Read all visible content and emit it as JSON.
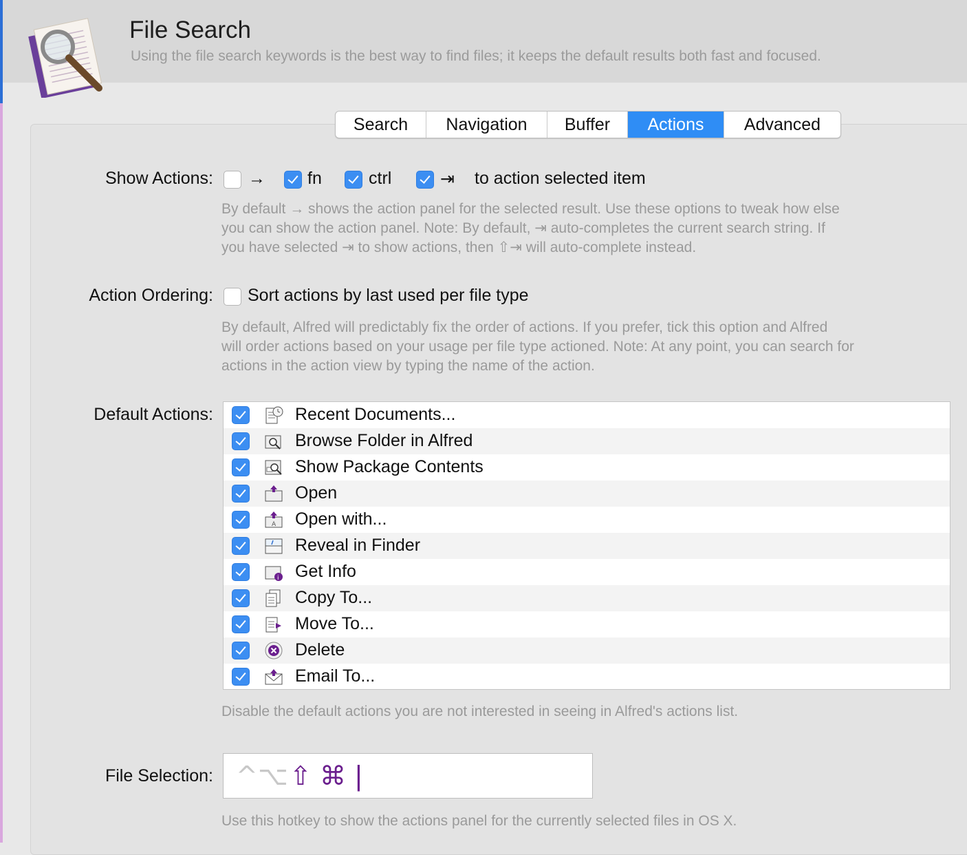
{
  "header": {
    "title": "File Search",
    "subtitle": "Using the file search keywords is the best way to find files; it keeps the default results both fast and focused."
  },
  "tabs": [
    {
      "label": "Search",
      "active": false
    },
    {
      "label": "Navigation",
      "active": false
    },
    {
      "label": "Buffer",
      "active": false
    },
    {
      "label": "Actions",
      "active": true
    },
    {
      "label": "Advanced",
      "active": false
    }
  ],
  "show_actions": {
    "label": "Show Actions:",
    "options": [
      {
        "glyph": "→",
        "checked": false
      },
      {
        "glyph": "fn",
        "checked": true
      },
      {
        "glyph": "ctrl",
        "checked": true
      },
      {
        "glyph": "⇥",
        "checked": true
      }
    ],
    "suffix": "to action selected item",
    "description": [
      "By default → shows the action panel for the selected result. Use these options to tweak how else",
      "you can show the action panel. Note: By default, ⇥ auto-completes the current search string. If",
      "you have selected ⇥ to show actions, then ⇧⇥ will auto-complete instead."
    ]
  },
  "action_ordering": {
    "label": "Action Ordering:",
    "checkbox_label": "Sort actions by last used per file type",
    "checked": false,
    "description": [
      "By default, Alfred will predictably fix the order of actions. If you prefer, tick this option and Alfred",
      "will order actions based on your usage per file type actioned. Note: At any point, you can search for",
      "actions in the action view by typing the name of the action."
    ]
  },
  "default_actions": {
    "label": "Default Actions:",
    "items": [
      {
        "label": "Recent Documents...",
        "icon": "recent-documents-icon",
        "checked": true
      },
      {
        "label": "Browse Folder in Alfred",
        "icon": "browse-folder-icon",
        "checked": true
      },
      {
        "label": "Show Package Contents",
        "icon": "package-contents-icon",
        "checked": true
      },
      {
        "label": "Open",
        "icon": "open-folder-icon",
        "checked": true
      },
      {
        "label": "Open with...",
        "icon": "open-with-icon",
        "checked": true
      },
      {
        "label": "Reveal in Finder",
        "icon": "finder-icon",
        "checked": true
      },
      {
        "label": "Get Info",
        "icon": "info-icon",
        "checked": true
      },
      {
        "label": "Copy To...",
        "icon": "copy-icon",
        "checked": true
      },
      {
        "label": "Move To...",
        "icon": "move-icon",
        "checked": true
      },
      {
        "label": "Delete",
        "icon": "delete-icon",
        "checked": true
      },
      {
        "label": "Email To...",
        "icon": "email-icon",
        "checked": true
      }
    ],
    "description": "Disable the default actions you are not interested in seeing in Alfred's actions list."
  },
  "file_selection": {
    "label": "File Selection:",
    "modifiers": [
      {
        "glyph": "^",
        "active": false
      },
      {
        "glyph": "⌥",
        "active": false
      },
      {
        "glyph": "⇧",
        "active": true
      },
      {
        "glyph": "⌘",
        "active": true
      },
      {
        "glyph": "|",
        "active": true
      }
    ],
    "description": "Use this hotkey to show the actions panel for the currently selected files in OS X."
  },
  "colors": {
    "accent": "#2f8df5",
    "hotkey_active": "#6b1f8e",
    "hotkey_inactive": "#c8c8c8",
    "description_text": "#9a9a9a"
  }
}
